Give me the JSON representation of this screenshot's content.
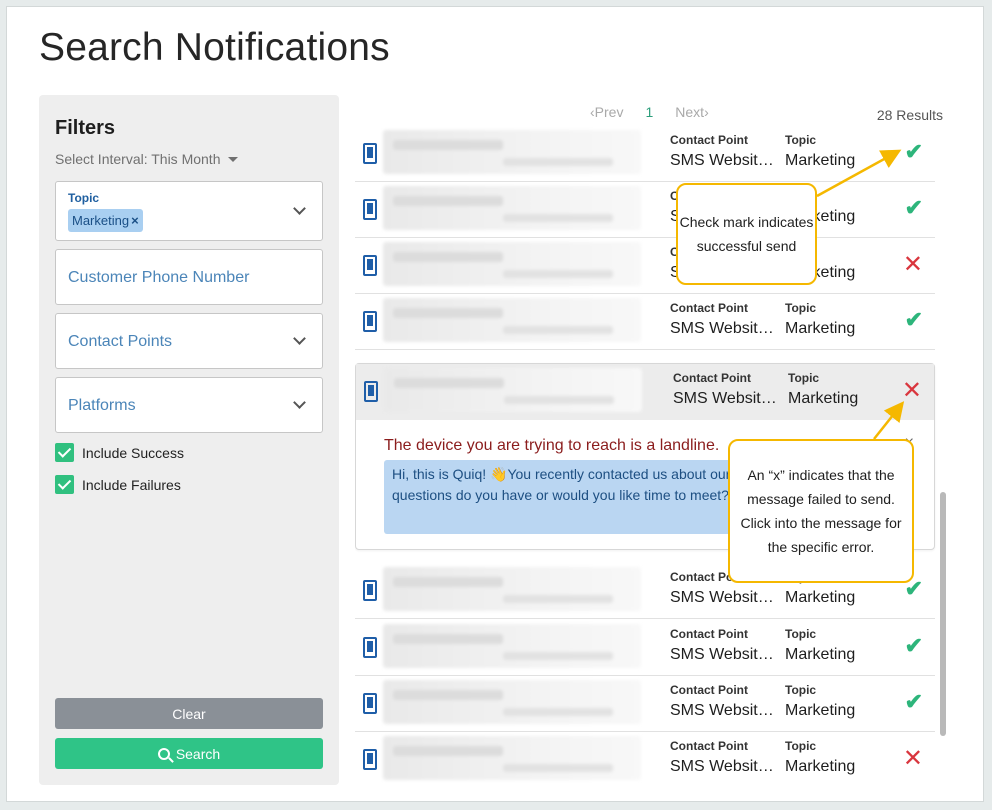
{
  "page": {
    "title": "Search Notifications"
  },
  "filters": {
    "title": "Filters",
    "interval": "Select Interval: This Month",
    "topic": {
      "label": "Topic",
      "chip": "Marketing",
      "chip_remove": "×"
    },
    "phone_placeholder": "Customer Phone Number",
    "contact_points_placeholder": "Contact Points",
    "platforms_placeholder": "Platforms",
    "include_success": "Include Success",
    "include_failures": "Include Failures",
    "clear_label": "Clear",
    "search_label": "Search"
  },
  "pager": {
    "prev": "Prev",
    "current": "1",
    "next": "Next",
    "results": "28 Results"
  },
  "columns": {
    "contact_point": "Contact Point",
    "topic": "Topic"
  },
  "rows": [
    {
      "contact_point": "SMS Websit…",
      "topic": "Marketing",
      "status": "success"
    },
    {
      "contact_point": "SMS Websit…",
      "topic": "Marketing",
      "status": "success"
    },
    {
      "contact_point": "SMS Websit…",
      "topic": "Marketing",
      "status": "failure"
    },
    {
      "contact_point": "SMS Websit…",
      "topic": "Marketing",
      "status": "success"
    },
    {
      "contact_point": "SMS Websit…",
      "topic": "Marketing",
      "status": "failure"
    },
    {
      "contact_point": "SMS Websit…",
      "topic": "Marketing",
      "status": "success"
    },
    {
      "contact_point": "SMS Websit…",
      "topic": "Marketing",
      "status": "success"
    },
    {
      "contact_point": "SMS Websit…",
      "topic": "Marketing",
      "status": "success"
    },
    {
      "contact_point": "SMS Websit…",
      "topic": "Marketing",
      "status": "failure"
    }
  ],
  "expanded": {
    "error": "The device you are trying to reach is a landline.",
    "close": "×",
    "message": "Hi, this is Quiq! 👋You recently contacted us about our solution. What questions do you have or would you like time to meet?"
  },
  "icons": {
    "success": "✔",
    "failure": "✕"
  },
  "callouts": {
    "check": "Check mark indicates successful send",
    "x": "An “x” indicates that the message failed to send. Click into the message for the specific error."
  },
  "colors": {
    "accent": "#2fc487",
    "success": "#2db57b",
    "failure": "#d9363e",
    "callout_border": "#f5b800",
    "link": "#1f5ea8"
  }
}
